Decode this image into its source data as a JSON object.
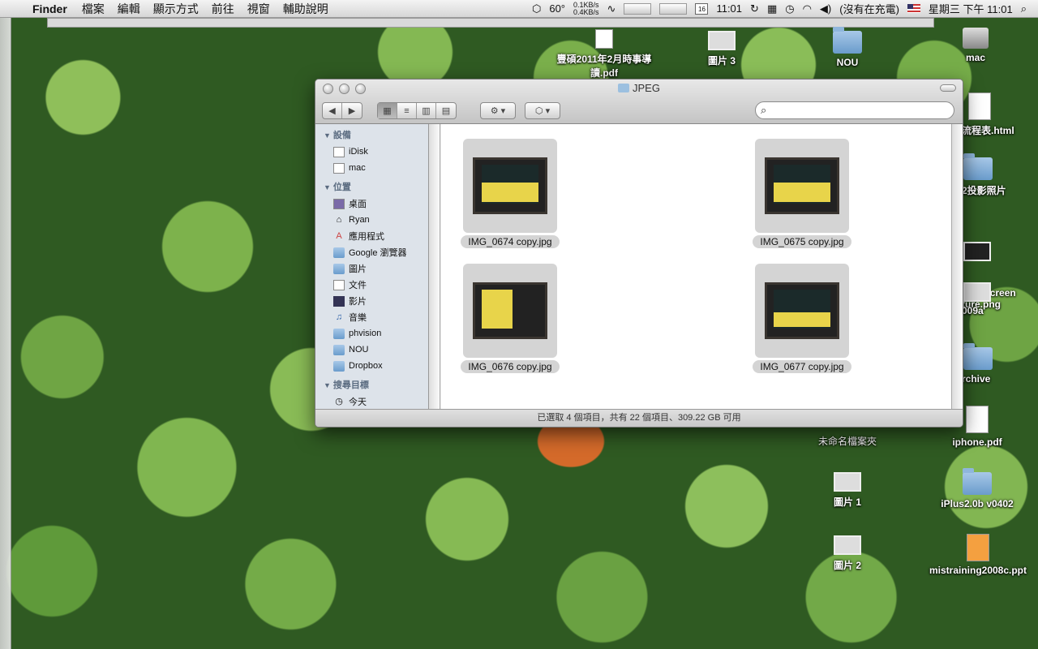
{
  "menubar": {
    "app": "Finder",
    "menus": [
      "檔案",
      "編輯",
      "顯示方式",
      "前往",
      "視窗",
      "輔助說明"
    ],
    "temp": "60°",
    "net_up": "0.1KB/s",
    "net_down": "0.4KB/s",
    "calendar_day": "16",
    "clock_small": "11:01",
    "battery": "(沒有在充電)",
    "datetime": "星期三 下午 11:01"
  },
  "window": {
    "title": "JPEG",
    "status": "已選取 4 個項目，共有 22 個項目、309.22 GB 可用"
  },
  "sidebar": {
    "devices_header": "設備",
    "devices": [
      {
        "label": "iDisk",
        "icon": "idisk-icon"
      },
      {
        "label": "mac",
        "icon": "harddisk-icon"
      }
    ],
    "places_header": "位置",
    "places": [
      {
        "label": "桌面",
        "icon": "desktop-icon"
      },
      {
        "label": "Ryan",
        "icon": "home-icon"
      },
      {
        "label": "應用程式",
        "icon": "applications-icon"
      },
      {
        "label": "Google 瀏覽器",
        "icon": "folder-icon"
      },
      {
        "label": "圖片",
        "icon": "pictures-icon"
      },
      {
        "label": "文件",
        "icon": "documents-icon"
      },
      {
        "label": "影片",
        "icon": "movies-icon"
      },
      {
        "label": "音樂",
        "icon": "music-icon"
      },
      {
        "label": "phvision",
        "icon": "folder-icon"
      },
      {
        "label": "NOU",
        "icon": "folder-icon"
      },
      {
        "label": "Dropbox",
        "icon": "dropbox-icon"
      }
    ],
    "search_header": "搜尋目標",
    "search_first": "今天"
  },
  "files": [
    {
      "name": "IMG_0674 copy.jpg"
    },
    {
      "name": "IMG_0675 copy.jpg"
    },
    {
      "name": "IMG_0676 copy.jpg"
    },
    {
      "name": "IMG_0677 copy.jpg"
    }
  ],
  "desktop": {
    "pdf1": "豐碩2011年2月時事導讀.pdf",
    "pic3": "圖片 3",
    "nou": "NOU",
    "mac": "mac",
    "html": "流程表.html",
    "photos": "2投影照片",
    "screen": "9.99 Screen\nture.png",
    "p2009": "009a",
    "archive": "rchive",
    "untitled": "未命名檔案夾",
    "iphone": "iphone.pdf",
    "pic1": "圖片 1",
    "iplus": "iPlus2.0b v0402",
    "pic2": "圖片 2",
    "ppt": "mistraining2008c.ppt"
  }
}
